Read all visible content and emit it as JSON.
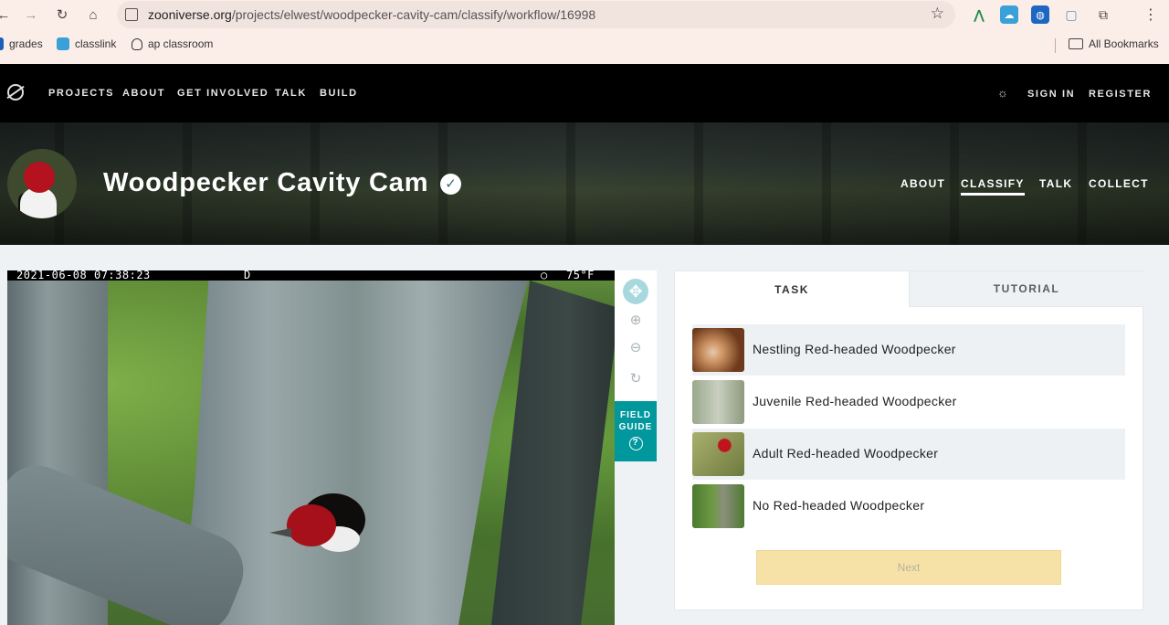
{
  "browser": {
    "url_domain": "zooniverse.org",
    "url_path": "/projects/elwest/woodpecker-cavity-cam/classify/workflow/16998",
    "bookmarks": [
      {
        "label": "grades"
      },
      {
        "label": "classlink"
      },
      {
        "label": "ap classroom"
      }
    ],
    "all_bookmarks": "All Bookmarks"
  },
  "zooniverse_nav": {
    "links": [
      "PROJECTS",
      "ABOUT",
      "GET INVOLVED",
      "TALK",
      "BUILD"
    ],
    "sign_in": "SIGN IN",
    "register": "REGISTER"
  },
  "project": {
    "title": "Woodpecker Cavity Cam",
    "nav": [
      "ABOUT",
      "CLASSIFY",
      "TALK",
      "COLLECT"
    ],
    "active_nav": "CLASSIFY"
  },
  "subject": {
    "timestamp": "2021-06-08 07:38:23",
    "mode": "D",
    "temperature": "75°F"
  },
  "viewer_controls": {
    "icons": [
      "move-icon",
      "zoom-in-icon",
      "zoom-out-icon",
      "rotate-icon"
    ],
    "field_guide_line1": "FIELD",
    "field_guide_line2": "GUIDE",
    "field_guide_help": "?"
  },
  "task_panel": {
    "tabs": [
      "TASK",
      "TUTORIAL"
    ],
    "active_tab": "TASK",
    "answers": [
      {
        "label": "Nestling Red-headed Woodpecker"
      },
      {
        "label": "Juvenile Red-headed Woodpecker"
      },
      {
        "label": "Adult Red-headed Woodpecker"
      },
      {
        "label": "No Red-headed Woodpecker"
      }
    ],
    "next_label": "Next"
  },
  "colors": {
    "accent_teal": "#00979d",
    "next_button": "#f6e2a7",
    "nav_bg": "#000000"
  }
}
